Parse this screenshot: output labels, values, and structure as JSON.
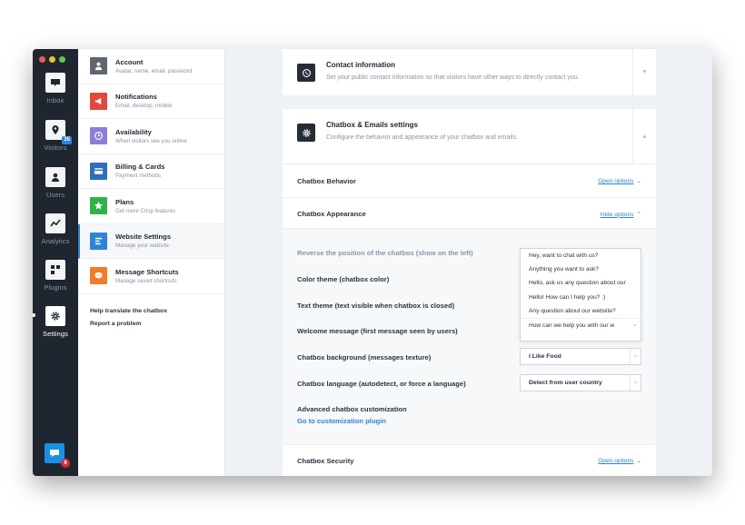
{
  "colors": {
    "rail_bg": "#1f2630",
    "accent": "#2e84d6",
    "dot_close": "#ee5a52",
    "dot_min": "#f4bd30",
    "dot_max": "#5ec84a"
  },
  "rail": {
    "items": [
      {
        "label": "Inbox",
        "icon": "inbox-icon"
      },
      {
        "label": "Visitors",
        "icon": "location-pin-icon",
        "badge": "35"
      },
      {
        "label": "Users",
        "icon": "user-icon"
      },
      {
        "label": "Analytics",
        "icon": "analytics-icon"
      },
      {
        "label": "Plugins",
        "icon": "plugins-icon"
      },
      {
        "label": "Settings",
        "icon": "gear-icon"
      }
    ],
    "chat_badge": "6"
  },
  "menu": {
    "items": [
      {
        "title": "Account",
        "sub": "Avatar, name, email, password",
        "icon": "account-icon",
        "color": "#5f6670"
      },
      {
        "title": "Notifications",
        "sub": "Email, desktop, mobile",
        "icon": "megaphone-icon",
        "color": "#e04a3c"
      },
      {
        "title": "Availability",
        "sub": "When visitors see you online",
        "icon": "clock-icon",
        "color": "#8c7fd8"
      },
      {
        "title": "Billing & Cards",
        "sub": "Payment methods",
        "icon": "card-icon",
        "color": "#2d6fb5"
      },
      {
        "title": "Plans",
        "sub": "Get more Crisp features",
        "icon": "star-icon",
        "color": "#2fb14c"
      },
      {
        "title": "Website Settings",
        "sub": "Manage your website",
        "icon": "website-icon",
        "color": "#2e84d6"
      },
      {
        "title": "Message Shortcuts",
        "sub": "Manage saved shortcuts",
        "icon": "speech-icon",
        "color": "#f07b2a"
      }
    ],
    "links": [
      "Help translate the chatbox",
      "Report a problem"
    ]
  },
  "content": {
    "contact": {
      "title": "Contact information",
      "sub": "Set your public contact information so that visitors have other ways to directly contact you."
    },
    "chatbox": {
      "title": "Chatbox & Emails settings",
      "sub": "Configure the behavior and appearance of your chatbox and emails."
    },
    "behavior": {
      "label": "Chatbox Behavior",
      "link": "Open options"
    },
    "appearance": {
      "label": "Chatbox Appearance",
      "link": "Hide options"
    },
    "settings": [
      "Reverse the position of the chatbox (show on the left)",
      "Color theme (chatbox color)",
      "Text theme (text visible when chatbox is closed)",
      "Welcome message (first message seen by users)",
      "Chatbox background (messages texture)",
      "Chatbox language (autodetect, or force a language)"
    ],
    "welcome_options": [
      "Hey, want to chat with us?",
      "Anything you want to ask?",
      "Hello, ask us any question about our",
      "Hello! How can I help you? :)",
      "Any question about our website?",
      "How can we help you with our w"
    ],
    "background_value": "I Like Food",
    "language_value": "Detect from user country",
    "advanced": {
      "title": "Advanced chatbox customization",
      "link": "Go to customization plugin"
    },
    "security": {
      "label": "Chatbox Security",
      "link": "Open options"
    }
  }
}
